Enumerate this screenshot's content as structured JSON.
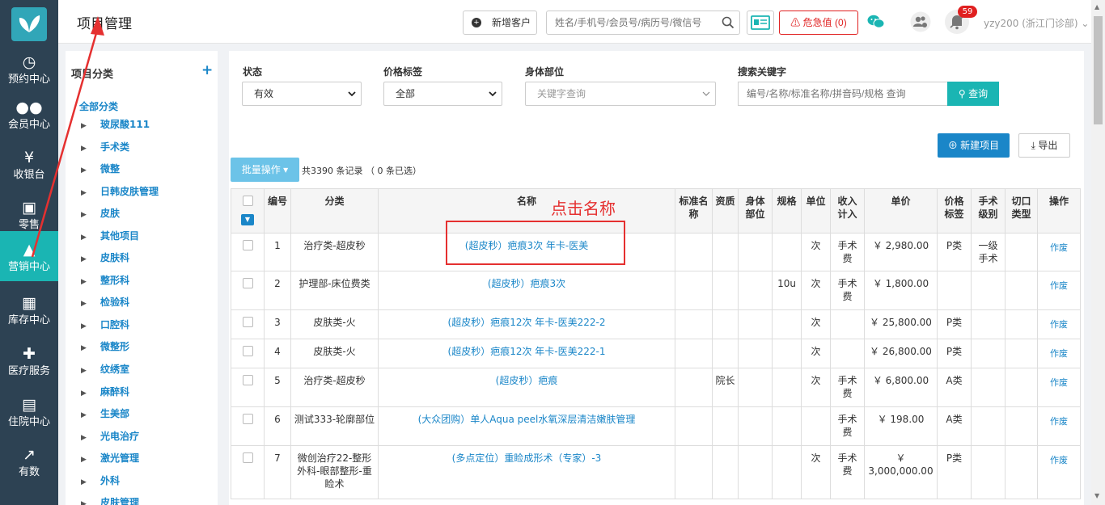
{
  "nav": {
    "items": [
      {
        "label": "预约中心",
        "icon": "clock-icon"
      },
      {
        "label": "会员中心",
        "icon": "users-icon"
      },
      {
        "label": "收银台",
        "icon": "yen-icon"
      },
      {
        "label": "零售",
        "icon": "cart-icon"
      },
      {
        "label": "营销中心",
        "icon": "megaphone-icon"
      },
      {
        "label": "库存中心",
        "icon": "grid-icon"
      },
      {
        "label": "医疗服务",
        "icon": "medkit-icon"
      },
      {
        "label": "住院中心",
        "icon": "building-icon"
      },
      {
        "label": "有数",
        "icon": "chart-line-icon"
      }
    ]
  },
  "header": {
    "title": "项目管理",
    "new_customer": "新增客户",
    "search_placeholder": "姓名/手机号/会员号/病历号/微信号",
    "critical_label": "危急值",
    "critical_count": "0",
    "bell_badge": "59",
    "user": "yzy200 (浙江门诊部)"
  },
  "category": {
    "title": "项目分类",
    "add": "+",
    "all": "全部分类",
    "items": [
      "玻尿酸111",
      "手术类",
      "微整",
      "日韩皮肤管理",
      "皮肤",
      "其他项目",
      "皮肤科",
      "整形科",
      "检验科",
      "口腔科",
      "微整形",
      "纹绣室",
      "麻醉科",
      "生美部",
      "光电治疗",
      "激光管理",
      "外科",
      "皮肤管理"
    ]
  },
  "filters": {
    "status_label": "状态",
    "status_value": "有效",
    "price_tag_label": "价格标签",
    "price_tag_value": "全部",
    "body_part_label": "身体部位",
    "body_part_placeholder": "关键字查询",
    "keyword_label": "搜索关键字",
    "keyword_placeholder": "编号/名称/标准名称/拼音码/规格 查询",
    "query_btn": "查询"
  },
  "toolbar": {
    "new_item": "新建项目",
    "export": "导出",
    "batch": "批量操作",
    "record_count": "共3390 条记录 （ 0 条已选）"
  },
  "table": {
    "headers": [
      "",
      "编号",
      "分类",
      "名称",
      "标准名称",
      "资质",
      "身体部位",
      "规格",
      "单位",
      "收入计入",
      "单价",
      "价格标签",
      "手术级别",
      "切口类型",
      "操作"
    ],
    "rows": [
      [
        "1",
        "治疗类-超皮秒",
        "(超皮秒）疤痕3次 年卡-医美",
        "",
        "",
        "",
        "",
        "次",
        "手术费",
        "￥ 2,980.00",
        "P类",
        "一级手术",
        "",
        "作废"
      ],
      [
        "2",
        "护理部-床位费类",
        "(超皮秒）疤痕3次",
        "",
        "",
        "",
        "10u",
        "次",
        "手术费",
        "￥ 1,800.00",
        "",
        "",
        "",
        "作废"
      ],
      [
        "3",
        "皮肤类-火",
        "(超皮秒）疤痕12次 年卡-医美222-2",
        "",
        "",
        "",
        "",
        "次",
        "",
        "￥ 25,800.00",
        "P类",
        "",
        "",
        "作废"
      ],
      [
        "4",
        "皮肤类-火",
        "(超皮秒）疤痕12次 年卡-医美222-1",
        "",
        "",
        "",
        "",
        "次",
        "",
        "￥ 26,800.00",
        "P类",
        "",
        "",
        "作废"
      ],
      [
        "5",
        "治疗类-超皮秒",
        "(超皮秒）疤痕",
        "",
        "院长",
        "",
        "",
        "次",
        "手术费",
        "￥ 6,800.00",
        "A类",
        "",
        "",
        "作废"
      ],
      [
        "6",
        "测试333-轮廓部位",
        "(大众团购）单人Aqua peel水氧深层清洁嫩肤管理",
        "",
        "",
        "",
        "",
        "",
        "手术费",
        "￥ 198.00",
        "A类",
        "",
        "",
        "作废"
      ],
      [
        "7",
        "微创治疗22-整形外科-眼部整形-重睑术",
        "(多点定位）重睑成形术（专家）-3",
        "",
        "",
        "",
        "",
        "次",
        "手术费",
        "￥ 3,000,000.00",
        "P类",
        "",
        "",
        "作废"
      ]
    ]
  },
  "annotation": {
    "text": "点击名称"
  }
}
